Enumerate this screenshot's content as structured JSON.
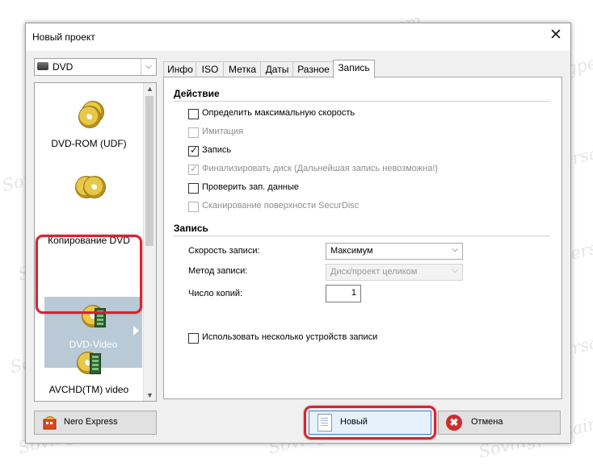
{
  "window": {
    "title": "Новый проект",
    "close_glyph": "✕"
  },
  "media_selector": {
    "value": "DVD",
    "arrow": "⌵",
    "icon": "dvd-drive-icon"
  },
  "left_list": {
    "items": [
      {
        "label": "DVD-ROM (UDF)",
        "icon": "dvd-rom-disc-icon",
        "selected": false
      },
      {
        "label": "Копирование DVD",
        "icon": "copy-dvd-disc-icon",
        "selected": false
      },
      {
        "label": "DVD-Video",
        "icon": "dvd-video-disc-icon",
        "selected": true
      },
      {
        "label": "AVCHD(TM) video",
        "icon": "avchd-video-disc-icon",
        "selected": false
      }
    ],
    "scroll_up": "▲",
    "scroll_down": "▼"
  },
  "tabs": [
    {
      "label": "Инфо",
      "active": false
    },
    {
      "label": "ISO",
      "active": false
    },
    {
      "label": "Метка",
      "active": false
    },
    {
      "label": "Даты",
      "active": false
    },
    {
      "label": "Разное",
      "active": false
    },
    {
      "label": "Запись",
      "active": true
    }
  ],
  "action_section": {
    "title": "Действие",
    "options": [
      {
        "label": "Определить максимальную скорость",
        "checked": false,
        "enabled": true
      },
      {
        "label": "Имитация",
        "checked": false,
        "enabled": false
      },
      {
        "label": "Запись",
        "checked": true,
        "enabled": true
      },
      {
        "label": "Финализировать диск (Дальнейшая запись невозможна!)",
        "checked": true,
        "enabled": false
      },
      {
        "label": "Проверить зап. данные",
        "checked": false,
        "enabled": true
      },
      {
        "label": "Сканирование поверхности SecurDisc",
        "checked": false,
        "enabled": false
      }
    ]
  },
  "write_section": {
    "title": "Запись",
    "speed_label": "Скорость записи:",
    "speed_value": "Максимум",
    "method_label": "Метод записи:",
    "method_value": "Диск/проект целиком",
    "copies_label": "Число копий:",
    "copies_value": "1",
    "multi_device_label": "Использовать несколько устройств записи",
    "multi_device_checked": false,
    "dropdown_arrow": "⌵"
  },
  "buttons": {
    "nero_express": "Nero Express",
    "new": "Новый",
    "cancel": "Отмена",
    "cancel_glyph": "✖"
  },
  "watermark": "Sovingpersair.com",
  "colors": {
    "highlight": "#d9232f",
    "selected_bg": "#b9c9d6",
    "primary_border": "#3a7fd5"
  }
}
